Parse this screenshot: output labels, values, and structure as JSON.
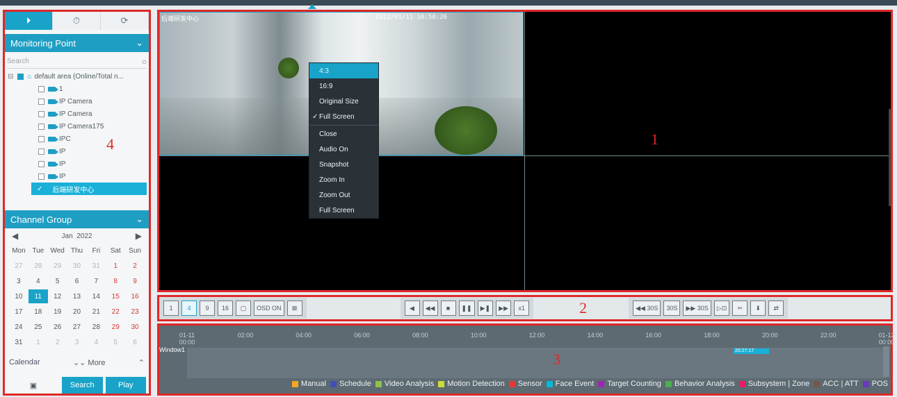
{
  "sidebar": {
    "tabs": [
      "⏵",
      "⏱",
      "⟳"
    ],
    "monitoring_point": {
      "title": "Monitoring Point",
      "search_placeholder": "Search",
      "root": "default area (Online/Total n...",
      "items": [
        "1",
        "IP Camera",
        "IP Camera",
        "IP Camera175",
        "IPC",
        "IP",
        "IP",
        "IP"
      ],
      "selected": "后端研发中心"
    },
    "channel_group": {
      "title": "Channel Group"
    },
    "calendar": {
      "month": "Jan",
      "year": "2022",
      "weekdays": [
        "Mon",
        "Tue",
        "Wed",
        "Thu",
        "Fri",
        "Sat",
        "Sun"
      ],
      "days": [
        [
          "27",
          "28",
          "29",
          "30",
          "31",
          "1",
          "2"
        ],
        [
          "3",
          "4",
          "5",
          "6",
          "7",
          "8",
          "9"
        ],
        [
          "10",
          "11",
          "12",
          "13",
          "14",
          "15",
          "16"
        ],
        [
          "17",
          "18",
          "19",
          "20",
          "21",
          "22",
          "23"
        ],
        [
          "24",
          "25",
          "26",
          "27",
          "28",
          "29",
          "30"
        ],
        [
          "31",
          "1",
          "2",
          "3",
          "4",
          "5",
          "6"
        ]
      ],
      "today": "11"
    },
    "calendar_label": "Calendar",
    "more_label": "More",
    "search_btn": "Search",
    "play_btn": "Play"
  },
  "video": {
    "overlay_left": "后端研发中心",
    "overlay_right": "2022/01/11 16:58:26",
    "context_menu": [
      "4:3",
      "16:9",
      "Original Size",
      "Full Screen",
      "Close",
      "Audio On",
      "Snapshot",
      "Zoom In",
      "Zoom Out",
      "Full Screen"
    ]
  },
  "toolbar": {
    "layout": [
      "1",
      "4",
      "9",
      "16",
      "▢",
      "OSD ON",
      "⊠"
    ],
    "playback": [
      "◀",
      "◀◀",
      "■",
      "❚❚",
      "▶❚",
      "▶▶",
      "x1"
    ],
    "right": [
      "◀◀ 30S",
      "30S",
      "▶▶ 30S",
      "▷⊡",
      "✂",
      "⬇",
      "⇄"
    ]
  },
  "timeline": {
    "ticks": [
      "01-11\n00:00",
      "02:00",
      "04:00",
      "06:00",
      "08:00",
      "10:00",
      "12:00",
      "14:00",
      "16:00",
      "18:00",
      "20:00",
      "22:00",
      "01-12\n00:00"
    ],
    "window": "Window1",
    "record_time": "20:27:17",
    "legend": [
      {
        "label": "Manual",
        "color": "#f5a623"
      },
      {
        "label": "Schedule",
        "color": "#3f51b5"
      },
      {
        "label": "Video Analysis",
        "color": "#8bc34a"
      },
      {
        "label": "Motion Detection",
        "color": "#cddc39"
      },
      {
        "label": "Sensor",
        "color": "#e53935"
      },
      {
        "label": "Face Event",
        "color": "#00bcd4"
      },
      {
        "label": "Target Counting",
        "color": "#9c27b0"
      },
      {
        "label": "Behavior Analysis",
        "color": "#4caf50"
      },
      {
        "label": "Subsystem | Zone",
        "color": "#e91e63"
      },
      {
        "label": "ACC | ATT",
        "color": "#795548"
      },
      {
        "label": "POS",
        "color": "#673ab7"
      }
    ]
  },
  "markers": [
    "1",
    "2",
    "3",
    "4"
  ]
}
